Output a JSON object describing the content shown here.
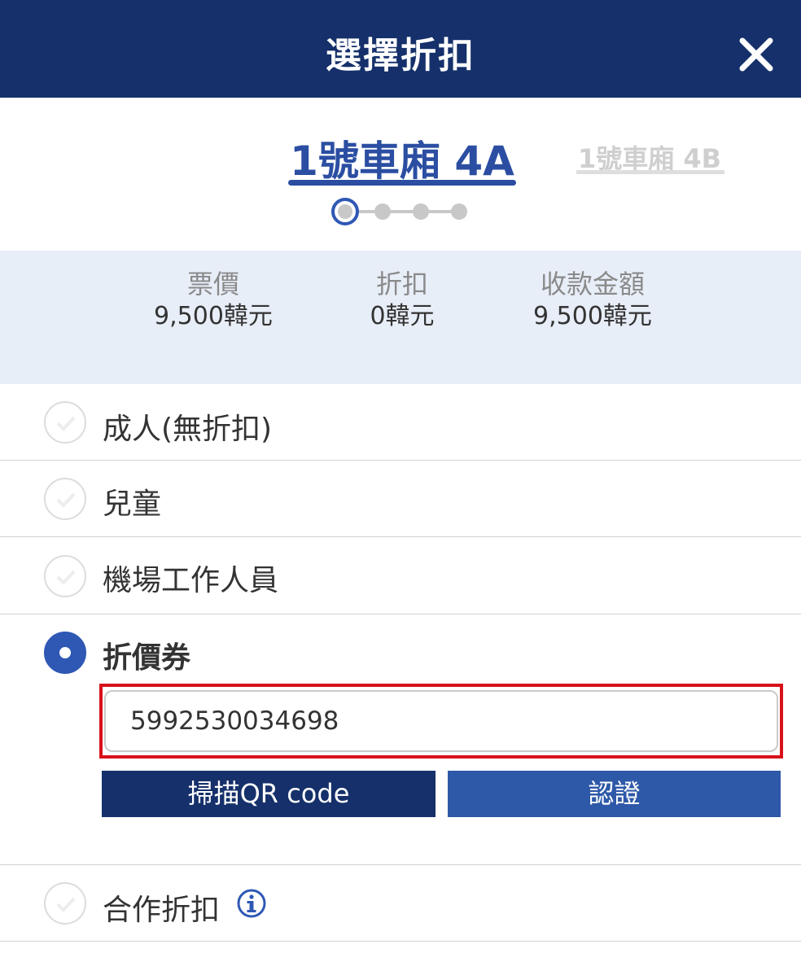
{
  "header": {
    "title": "選擇折扣",
    "close_icon": "close-icon"
  },
  "seat_tabs": [
    {
      "label": "1號車廂 4A",
      "active": true
    },
    {
      "label": "1號車廂 4B",
      "active": false
    }
  ],
  "steps": {
    "total": 4,
    "current": 1
  },
  "summary": {
    "price_label": "票價",
    "price_value": "9,500韓元",
    "discount_label": "折扣",
    "discount_value": "0韓元",
    "total_label": "收款金額",
    "total_value": "9,500韓元"
  },
  "options": [
    {
      "label": "成人(無折扣)",
      "selected": false
    },
    {
      "label": "兒童",
      "selected": false
    },
    {
      "label": "機場工作人員",
      "selected": false
    },
    {
      "label": "折價券",
      "selected": true
    },
    {
      "label": "合作折扣",
      "selected": false,
      "icon": "info-icon"
    }
  ],
  "coupon": {
    "value": "5992530034698",
    "scan_label": "掃描QR code",
    "verify_label": "認證"
  },
  "colors": {
    "header_bg": "#15306a",
    "accent": "#2f58b4",
    "summary_bg": "#e8eef8",
    "highlight": "#d8121b"
  }
}
